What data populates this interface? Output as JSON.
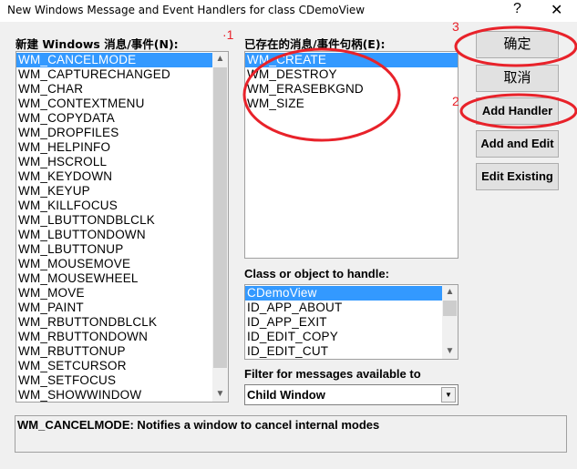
{
  "window": {
    "title": "New Windows Message and Event Handlers for class CDemoView",
    "help": "?",
    "close": "✕"
  },
  "new_messages": {
    "label": "新建 Windows 消息/事件(N):",
    "selected": 0,
    "items": [
      "WM_CANCELMODE",
      "WM_CAPTURECHANGED",
      "WM_CHAR",
      "WM_CONTEXTMENU",
      "WM_COPYDATA",
      "WM_DROPFILES",
      "WM_HELPINFO",
      "WM_HSCROLL",
      "WM_KEYDOWN",
      "WM_KEYUP",
      "WM_KILLFOCUS",
      "WM_LBUTTONDBLCLK",
      "WM_LBUTTONDOWN",
      "WM_LBUTTONUP",
      "WM_MOUSEMOVE",
      "WM_MOUSEWHEEL",
      "WM_MOVE",
      "WM_PAINT",
      "WM_RBUTTONDBLCLK",
      "WM_RBUTTONDOWN",
      "WM_RBUTTONUP",
      "WM_SETCURSOR",
      "WM_SETFOCUS",
      "WM_SHOWWINDOW"
    ]
  },
  "existing_handlers": {
    "label": "已存在的消息/事件句柄(E):",
    "selected": 0,
    "items": [
      "WM_CREATE",
      "WM_DESTROY",
      "WM_ERASEBKGND",
      "WM_SIZE"
    ]
  },
  "buttons": {
    "ok": "确定",
    "cancel": "取消",
    "add_handler": "Add Handler",
    "add_and_edit": "Add and Edit",
    "edit_existing": "Edit Existing"
  },
  "class_list": {
    "label": "Class or object to handle:",
    "selected": 0,
    "items": [
      "CDemoView",
      "ID_APP_ABOUT",
      "ID_APP_EXIT",
      "ID_EDIT_COPY",
      "ID_EDIT_CUT"
    ]
  },
  "filter": {
    "label": "Filter for messages available to",
    "value": "Child Window"
  },
  "status": "WM_CANCELMODE:  Notifies a window to cancel internal modes",
  "annotations": {
    "n1": "·1",
    "n2": "2",
    "n3": "3",
    "color": "#e8222a"
  }
}
